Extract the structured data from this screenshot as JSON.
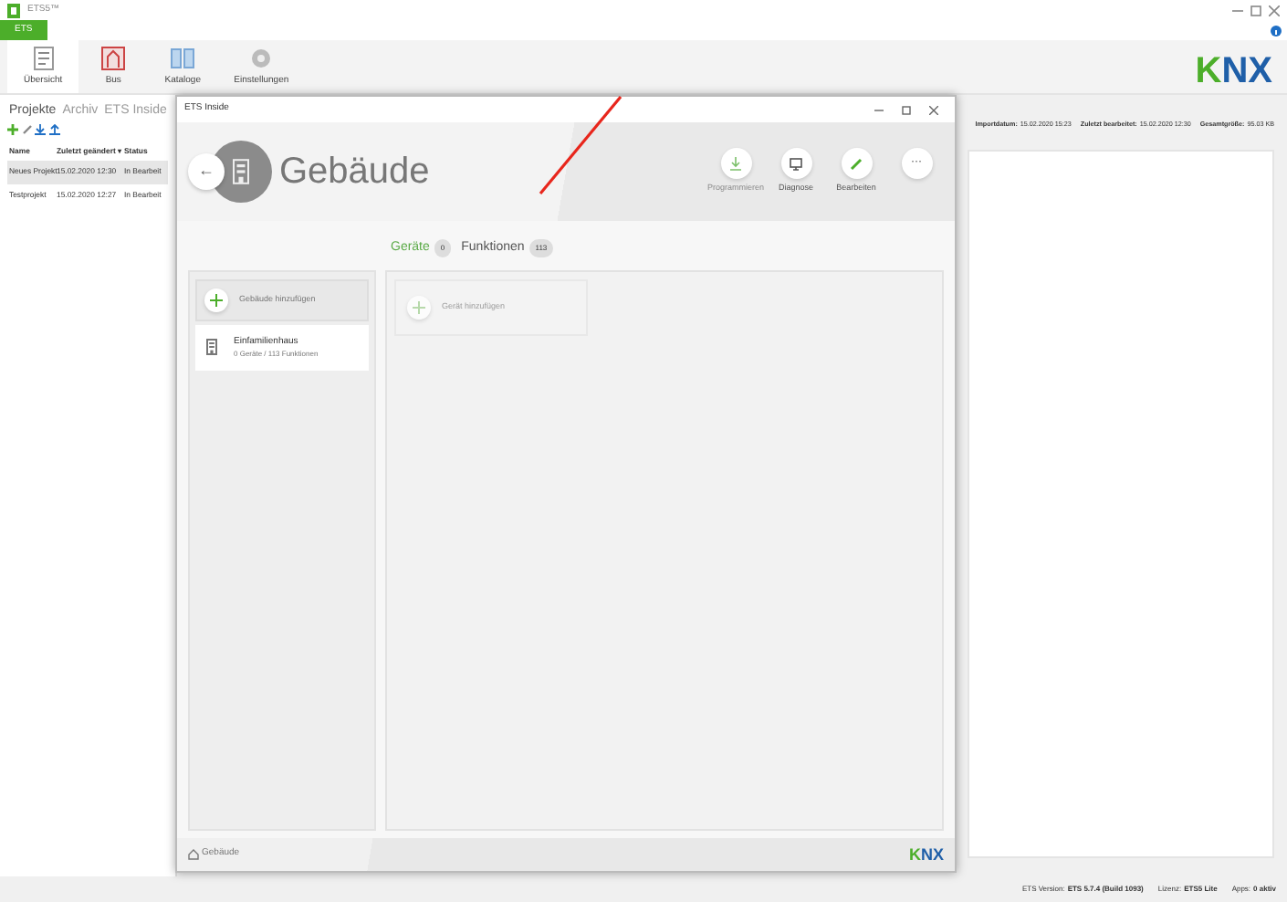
{
  "app": {
    "title": "ETS5™",
    "menu_tab": "ETS",
    "logo": "KNX",
    "ribbon": [
      {
        "label": "Übersicht",
        "selected": true,
        "kind": "overview"
      },
      {
        "label": "Bus",
        "selected": false,
        "kind": "bus"
      },
      {
        "label": "Kataloge",
        "selected": false,
        "kind": "catalog"
      },
      {
        "label": "Einstellungen",
        "selected": false,
        "kind": "settings"
      }
    ]
  },
  "projects": {
    "tabs": [
      {
        "label": "Projekte",
        "selected": true
      },
      {
        "label": "Archiv",
        "selected": false
      },
      {
        "label": "ETS Inside",
        "selected": false
      }
    ],
    "columns": [
      "Name",
      "Zuletzt geändert ▾",
      "Status"
    ],
    "rows": [
      {
        "cells": [
          "Neues Projekt",
          "15.02.2020 12:30",
          "In Bearbeit"
        ],
        "selected": true
      },
      {
        "cells": [
          "Testprojekt",
          "15.02.2020 12:27",
          "In Bearbeit"
        ],
        "selected": false
      }
    ]
  },
  "details": [
    {
      "label": "Importdatum:",
      "value": "15.02.2020 15:23"
    },
    {
      "label": "Zuletzt bearbeitet:",
      "value": "15.02.2020 12:30"
    },
    {
      "label": "Gesamtgröße:",
      "value": "95.03 KB"
    }
  ],
  "status_bar": [
    {
      "label": "ETS Version:",
      "value": "ETS 5.7.4 (Build 1093)"
    },
    {
      "label": "Lizenz:",
      "value": "ETS5 Lite"
    },
    {
      "label": "Apps:",
      "value": "0 aktiv"
    }
  ],
  "dialog": {
    "title": "ETS Inside",
    "heading": "Gebäude",
    "actions": [
      {
        "label": "Programmieren",
        "disabled": true,
        "kind": "download"
      },
      {
        "label": "Diagnose",
        "disabled": false,
        "kind": "monitor"
      },
      {
        "label": "Bearbeiten",
        "disabled": false,
        "kind": "edit"
      }
    ],
    "more_button": "···",
    "back_button": "←",
    "tabs": [
      {
        "label": "Geräte",
        "count": "0",
        "selected": true
      },
      {
        "label": "Funktionen",
        "count": "113",
        "selected": false
      }
    ],
    "add_building": "Gebäude hinzufügen",
    "buildings": [
      {
        "name": "Einfamilienhaus",
        "detail": "0 Geräte / 113 Funktionen"
      }
    ],
    "add_device": {
      "label": "Gerät hinzufügen",
      "disabled": true
    },
    "breadcrumb": "Gebäude",
    "logo": "KNX"
  }
}
